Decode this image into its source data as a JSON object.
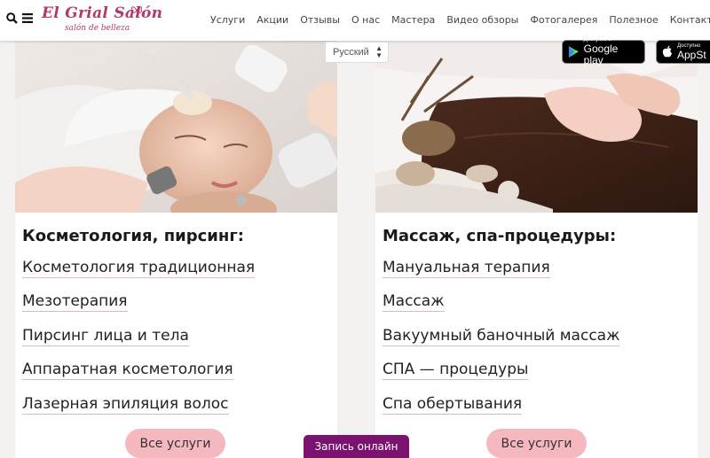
{
  "header": {
    "logo_main": "El Grial Salón",
    "logo_sub": "salón de belleza",
    "nav": [
      "Услуги",
      "Акции",
      "Отзывы",
      "О нас",
      "Мастера",
      "Видео обзоры",
      "Фотогалерея",
      "Полезное",
      "Контакты"
    ]
  },
  "language": {
    "selected": "Русский"
  },
  "stores": {
    "google": {
      "small": "Доступно в",
      "big": "Google play"
    },
    "apple": {
      "small": "Доступно",
      "big": "AppSt"
    }
  },
  "cards": [
    {
      "title": "Косметология, пирсинг:",
      "items": [
        "Косметология традиционная",
        "Мезотерапия",
        "Пирсинг лица и тела",
        "Аппаратная косметология",
        "Лазерная эпиляция волос"
      ],
      "button": "Все услуги"
    },
    {
      "title": "Массаж, спа-процедуры:",
      "items": [
        "Мануальная терапия",
        "Массаж",
        "Вакуумный баночный массаж",
        "СПА — процедуры",
        "Спа обертывания"
      ],
      "button": "Все услуги"
    }
  ],
  "online_button": "Запись онлайн",
  "colors": {
    "brand": "#b23a6b",
    "button": "#f4b8be",
    "online": "#7b1270"
  }
}
